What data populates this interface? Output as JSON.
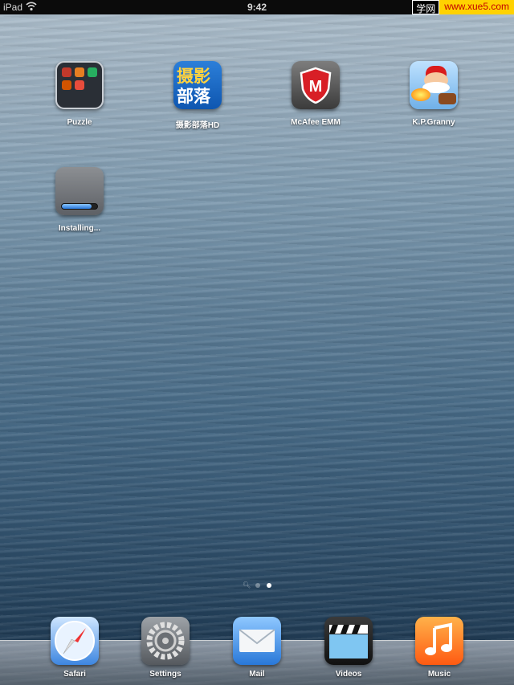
{
  "status_bar": {
    "device": "iPad",
    "time": "9:42",
    "watermark_left": "学网",
    "watermark_right": "www.xue5.com"
  },
  "home_apps": [
    {
      "label": "Puzzle",
      "icon": "folder-icon"
    },
    {
      "label": "摄影部落HD",
      "icon": "sheying-app-icon",
      "icon_text_top": "摄影",
      "icon_text_bottom": "部落"
    },
    {
      "label": "McAfee EMM",
      "icon": "mcafee-shield-icon",
      "icon_text": "M"
    },
    {
      "label": "K.P.Granny",
      "icon": "kp-granny-icon"
    },
    {
      "label": "Installing...",
      "icon": "installing-app-icon",
      "progress": 0.85
    }
  ],
  "page_dots": {
    "count": 3,
    "active_index": 2,
    "first_is_spotlight": true
  },
  "dock": [
    {
      "label": "Safari",
      "icon": "safari-compass-icon"
    },
    {
      "label": "Settings",
      "icon": "settings-gear-icon"
    },
    {
      "label": "Mail",
      "icon": "mail-envelope-icon"
    },
    {
      "label": "Videos",
      "icon": "videos-clapper-icon"
    },
    {
      "label": "Music",
      "icon": "music-note-icon"
    }
  ]
}
